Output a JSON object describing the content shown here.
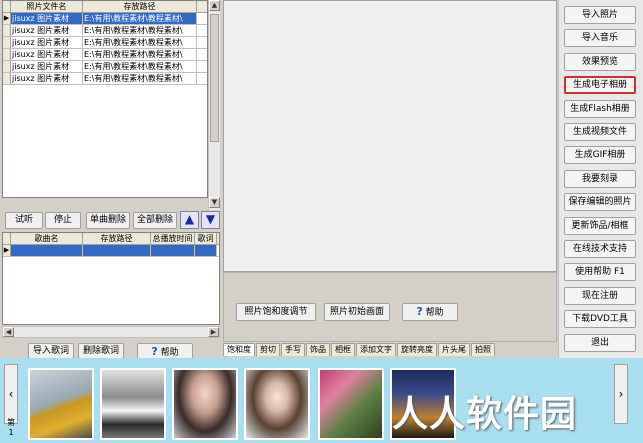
{
  "photo_table": {
    "columns": [
      "照片文件名",
      "存放路径"
    ],
    "rows": [
      {
        "name": "jisuxz 图片素材",
        "path": "E:\\有用\\教程素材\\教程素材\\"
      },
      {
        "name": "jisuxz 图片素材",
        "path": "E:\\有用\\教程素材\\教程素材\\"
      },
      {
        "name": "jisuxz 图片素材",
        "path": "E:\\有用\\教程素材\\教程素材\\"
      },
      {
        "name": "jisuxz 图片素材",
        "path": "E:\\有用\\教程素材\\教程素材\\"
      },
      {
        "name": "jisuxz 图片素材",
        "path": "E:\\有用\\教程素材\\教程素材\\"
      },
      {
        "name": "jisuxz 图片素材",
        "path": "E:\\有用\\教程素材\\教程素材\\"
      }
    ]
  },
  "music_controls": {
    "audition": "试听",
    "stop": "停止",
    "delete_one": "单曲删除",
    "delete_all": "全部删除"
  },
  "music_table": {
    "columns": [
      "歌曲名",
      "存放路径",
      "总播放时间",
      "歌词"
    ]
  },
  "lyrics_buttons": {
    "import": "导入歌词",
    "delete": "删除歌词",
    "help": "帮助"
  },
  "mid_buttons": {
    "saturation": "照片饱和度调节",
    "init": "照片初始画面",
    "help": "帮助"
  },
  "tabs": [
    "饱和度",
    "剪切",
    "手写",
    "饰品",
    "相框",
    "添加文字",
    "旋转亮度",
    "片头尾",
    "拍照"
  ],
  "right_buttons": [
    "导入照片",
    "导入音乐",
    "效果预览",
    "生成电子相册",
    "生成Flash相册",
    "生成视频文件",
    "生成GIF相册",
    "我要刻录",
    "保存编辑的照片",
    "更新饰品/相框",
    "在线技术支持",
    "使用帮助  F1",
    "现在注册",
    "下载DVD工具",
    "退出"
  ],
  "strip": {
    "page_label": "第 1",
    "watermark": "人人软件园"
  },
  "colors": {
    "selection": "#316ac5",
    "highlight_border": "#d03030",
    "strip_bg": "#a8dff0"
  }
}
